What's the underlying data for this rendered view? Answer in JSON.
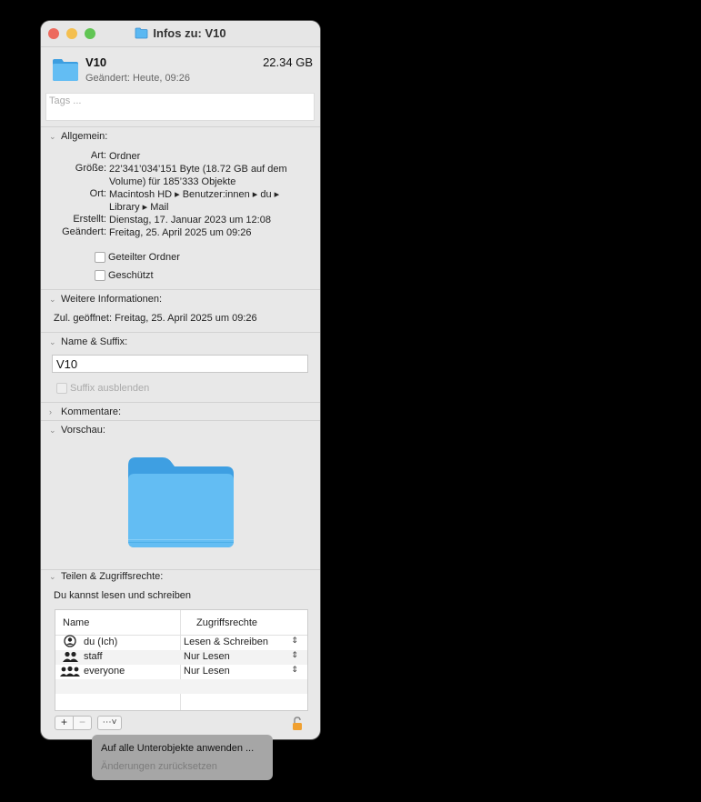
{
  "window": {
    "title": "Infos zu: V10"
  },
  "header": {
    "name": "V10",
    "size": "22.34 GB",
    "modified": "Geändert: Heute, 09:26",
    "tags_placeholder": "Tags ..."
  },
  "general": {
    "section_title": "Allgemein:",
    "rows": [
      {
        "label": "Art:",
        "value": "Ordner"
      },
      {
        "label": "Größe:",
        "value": "22’341’034’151 Byte (18.72 GB auf dem Volume) für 185’333 Objekte"
      },
      {
        "label": "Ort:",
        "value": "Macintosh HD ▸ Benutzer:innen ▸ du ▸ Library ▸ Mail"
      },
      {
        "label": "Erstellt:",
        "value": "Dienstag, 17. Januar 2023 um 12:08"
      },
      {
        "label": "Geändert:",
        "value": "Freitag, 25. April 2025 um 09:26"
      }
    ],
    "shared_label": "Geteilter Ordner",
    "locked_label": "Geschützt"
  },
  "more_info": {
    "section_title": "Weitere Informationen:",
    "last_opened": "Zul. geöffnet: Freitag, 25. April 2025 um 09:26"
  },
  "name_ext": {
    "section_title": "Name & Suffix:",
    "value": "V10",
    "hide_ext": "Suffix ausblenden"
  },
  "comments": {
    "section_title": "Kommentare:"
  },
  "preview": {
    "section_title": "Vorschau:"
  },
  "sharing": {
    "section_title": "Teilen & Zugriffsrechte:",
    "status": "Du kannst lesen und schreiben",
    "col_name": "Name",
    "col_priv": "Zugriffsrechte",
    "rows": [
      {
        "name": "du (Ich)",
        "priv": "Lesen & Schreiben",
        "icon": "person-circle-icon"
      },
      {
        "name": "staff",
        "priv": "Nur Lesen",
        "icon": "two-people-icon"
      },
      {
        "name": "everyone",
        "priv": "Nur Lesen",
        "icon": "group-icon"
      }
    ],
    "add": "+",
    "remove": "−"
  },
  "menu": {
    "apply": "Auf alle Unterobjekte anwenden ...",
    "revert": "Änderungen zurücksetzen"
  },
  "colors": {
    "folder": "#5ab8f2",
    "accent": "#f0a030"
  }
}
